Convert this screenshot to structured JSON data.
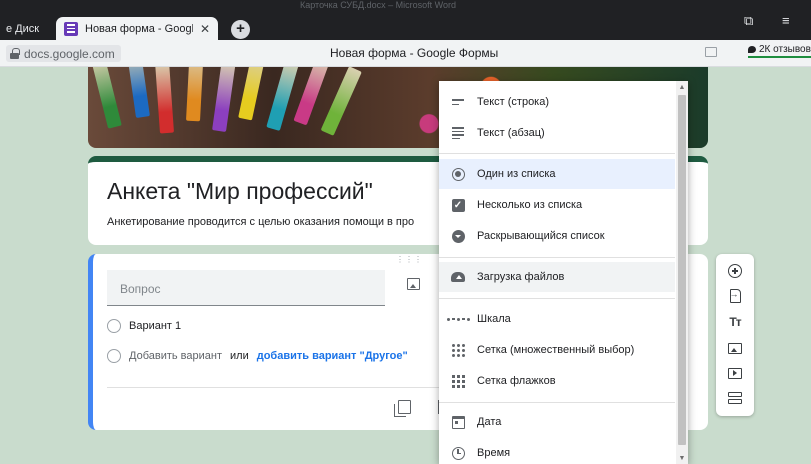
{
  "browser": {
    "os_caption": "Карточка СУБД.docx – Microsoft Word",
    "left_tab_label": "e Диск",
    "active_tab_title": "Новая форма - Google",
    "tab_close": "✕",
    "new_tab": "+",
    "restore_btn": "⧉",
    "menu_btn": "≡",
    "url": "docs.google.com",
    "page_title": "Новая форма - Google Формы",
    "reviews_label": "2К отзывов"
  },
  "form": {
    "title": "Анкета \"Мир профессий\"",
    "description": "Анкетирование проводится с целью оказания помощи в про",
    "question_placeholder": "Вопрос",
    "drag_handle": "⋮⋮⋮",
    "option1": "Вариант 1",
    "add_option": "Добавить вариант",
    "or_text": "или",
    "add_other": "добавить вариант \"Другое\""
  },
  "toolbar": {
    "items": [
      "add-question",
      "import-questions",
      "add-title",
      "add-image",
      "add-video",
      "add-section"
    ],
    "title_glyph": "Tт"
  },
  "menu": {
    "items": [
      {
        "label": "Текст (строка)",
        "icon": "short-text-icon"
      },
      {
        "label": "Текст (абзац)",
        "icon": "paragraph-icon"
      },
      {
        "label": "Один из списка",
        "icon": "radio-icon",
        "selected": true
      },
      {
        "label": "Несколько из списка",
        "icon": "checkbox-icon"
      },
      {
        "label": "Раскрывающийся список",
        "icon": "dropdown-icon"
      },
      {
        "label": "Загрузка файлов",
        "icon": "cloud-upload-icon",
        "hovered": true
      },
      {
        "label": "Шкала",
        "icon": "linear-scale-icon"
      },
      {
        "label": "Сетка (множественный выбор)",
        "icon": "grid-dots-icon"
      },
      {
        "label": "Сетка флажков",
        "icon": "grid-squares-icon"
      },
      {
        "label": "Дата",
        "icon": "calendar-icon"
      },
      {
        "label": "Время",
        "icon": "clock-icon"
      }
    ]
  },
  "colors": {
    "background": "#c9dccd",
    "theme": "#1e5b40",
    "accent": "#4285f4",
    "link": "#1a73e8"
  }
}
